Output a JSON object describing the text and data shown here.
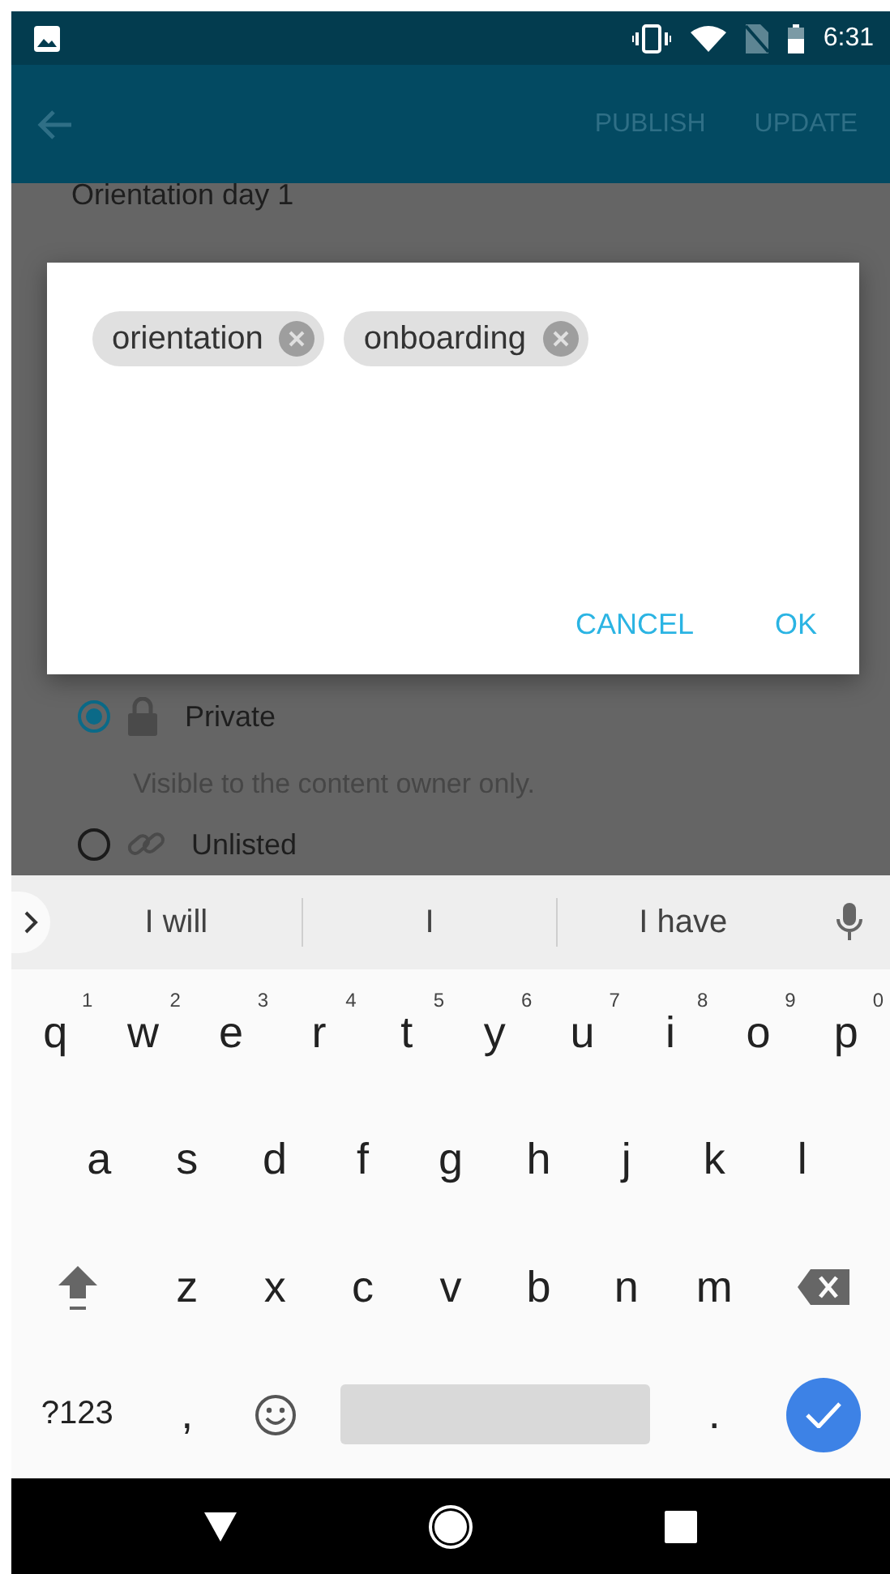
{
  "status_bar": {
    "time": "6:31"
  },
  "app_bar": {
    "actions": [
      {
        "label": "PUBLISH"
      },
      {
        "label": "UPDATE"
      }
    ]
  },
  "page": {
    "title": "Orientation day 1",
    "visibility_options": [
      {
        "label": "Private",
        "selected": true,
        "description": "Visible to the content owner only."
      },
      {
        "label": "Unlisted",
        "selected": false
      }
    ]
  },
  "dialog": {
    "tags": [
      {
        "label": "orientation"
      },
      {
        "label": "onboarding"
      }
    ],
    "buttons": [
      {
        "label": "CANCEL"
      },
      {
        "label": "OK"
      }
    ]
  },
  "keyboard": {
    "suggestions": [
      "I will",
      "I",
      "I have"
    ],
    "top_row": [
      {
        "kind": "letter",
        "label": "q",
        "hint": "1"
      },
      {
        "kind": "letter",
        "label": "w",
        "hint": "2"
      },
      {
        "kind": "letter",
        "label": "e",
        "hint": "3"
      },
      {
        "kind": "letter",
        "label": "r",
        "hint": "4"
      },
      {
        "kind": "letter",
        "label": "t",
        "hint": "5"
      },
      {
        "kind": "letter",
        "label": "y",
        "hint": "6"
      },
      {
        "kind": "letter",
        "label": "u",
        "hint": "7"
      },
      {
        "kind": "letter",
        "label": "i",
        "hint": "8"
      },
      {
        "kind": "letter",
        "label": "o",
        "hint": "9"
      },
      {
        "kind": "letter",
        "label": "p",
        "hint": "0"
      }
    ],
    "home_row": [
      {
        "kind": "letter",
        "label": "a"
      },
      {
        "kind": "letter",
        "label": "s"
      },
      {
        "kind": "letter",
        "label": "d"
      },
      {
        "kind": "letter",
        "label": "f"
      },
      {
        "kind": "letter",
        "label": "g"
      },
      {
        "kind": "letter",
        "label": "h"
      },
      {
        "kind": "letter",
        "label": "j"
      },
      {
        "kind": "letter",
        "label": "k"
      },
      {
        "kind": "letter",
        "label": "l"
      }
    ],
    "lower_row": [
      {
        "kind": "shift"
      },
      {
        "kind": "letter",
        "label": "z"
      },
      {
        "kind": "letter",
        "label": "x"
      },
      {
        "kind": "letter",
        "label": "c"
      },
      {
        "kind": "letter",
        "label": "v"
      },
      {
        "kind": "letter",
        "label": "b"
      },
      {
        "kind": "letter",
        "label": "n"
      },
      {
        "kind": "letter",
        "label": "m"
      },
      {
        "kind": "backspace"
      }
    ],
    "function_row": [
      {
        "kind": "symbols",
        "label": "?123"
      },
      {
        "kind": "letter",
        "label": ","
      },
      {
        "kind": "emoji"
      },
      {
        "kind": "space"
      },
      {
        "kind": "letter",
        "label": "."
      },
      {
        "kind": "enter"
      }
    ]
  }
}
